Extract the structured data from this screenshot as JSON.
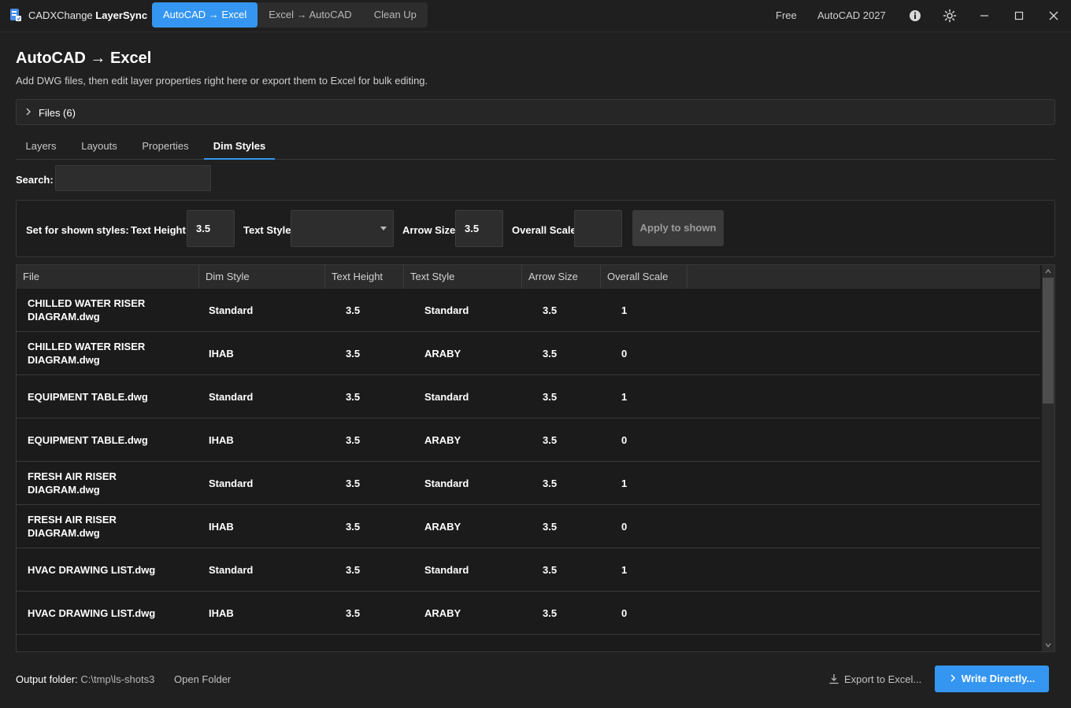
{
  "titlebar": {
    "app_name_prefix": "CADXChange ",
    "app_name_bold": "LayerSync",
    "mode_tabs": [
      {
        "label": "AutoCAD → Excel",
        "active": true
      },
      {
        "label": "Excel → AutoCAD",
        "active": false
      },
      {
        "label": "Clean Up",
        "active": false
      }
    ],
    "plan": "Free",
    "version": "AutoCAD 2027",
    "icons": [
      "info-icon",
      "theme-sun-icon",
      "minimize-icon",
      "maximize-icon",
      "close-icon"
    ]
  },
  "header": {
    "title": "AutoCAD → Excel",
    "subtitle": "Add DWG files, then edit layer properties right here or export them to Excel for bulk editing."
  },
  "files": {
    "label": "Files (6)"
  },
  "tabs": [
    {
      "label": "Layers",
      "active": false
    },
    {
      "label": "Layouts",
      "active": false
    },
    {
      "label": "Properties",
      "active": false
    },
    {
      "label": "Dim Styles",
      "active": true
    }
  ],
  "search": {
    "label": "Search:",
    "value": ""
  },
  "bulk": {
    "label": "Set for shown styles:",
    "text_height_label": "Text Height",
    "text_height_value": "3.5",
    "text_style_label": "Text Style",
    "text_style_value": "",
    "arrow_size_label": "Arrow Size",
    "arrow_size_value": "3.5",
    "overall_scale_label": "Overall Scale",
    "overall_scale_value": "",
    "apply_label": "Apply to shown"
  },
  "table": {
    "columns": [
      "File",
      "Dim Style",
      "Text Height",
      "Text Style",
      "Arrow Size",
      "Overall Scale"
    ],
    "rows": [
      {
        "file": "CHILLED WATER RISER DIAGRAM.dwg",
        "dim_style": "Standard",
        "text_height": "3.5",
        "text_style": "Standard",
        "arrow_size": "3.5",
        "overall_scale": "1"
      },
      {
        "file": "CHILLED WATER RISER DIAGRAM.dwg",
        "dim_style": "IHAB",
        "text_height": "3.5",
        "text_style": "ARABY",
        "arrow_size": "3.5",
        "overall_scale": "0"
      },
      {
        "file": "EQUIPMENT TABLE.dwg",
        "dim_style": "Standard",
        "text_height": "3.5",
        "text_style": "Standard",
        "arrow_size": "3.5",
        "overall_scale": "1"
      },
      {
        "file": "EQUIPMENT TABLE.dwg",
        "dim_style": "IHAB",
        "text_height": "3.5",
        "text_style": "ARABY",
        "arrow_size": "3.5",
        "overall_scale": "0"
      },
      {
        "file": "FRESH AIR RISER DIAGRAM.dwg",
        "dim_style": "Standard",
        "text_height": "3.5",
        "text_style": "Standard",
        "arrow_size": "3.5",
        "overall_scale": "1"
      },
      {
        "file": "FRESH AIR RISER DIAGRAM.dwg",
        "dim_style": "IHAB",
        "text_height": "3.5",
        "text_style": "ARABY",
        "arrow_size": "3.5",
        "overall_scale": "0"
      },
      {
        "file": "HVAC DRAWING LIST.dwg",
        "dim_style": "Standard",
        "text_height": "3.5",
        "text_style": "Standard",
        "arrow_size": "3.5",
        "overall_scale": "1"
      },
      {
        "file": "HVAC DRAWING LIST.dwg",
        "dim_style": "IHAB",
        "text_height": "3.5",
        "text_style": "ARABY",
        "arrow_size": "3.5",
        "overall_scale": "0"
      }
    ]
  },
  "footer": {
    "output_label": "Output folder:",
    "output_path": "C:\\tmp\\ls-shots3",
    "open_folder": "Open Folder",
    "export_label": "Export to Excel...",
    "write_label": "Write Directly..."
  },
  "colors": {
    "accent": "#3596f1",
    "background": "#202020"
  }
}
